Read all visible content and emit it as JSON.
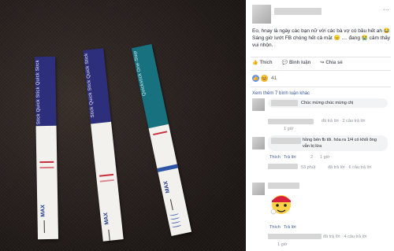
{
  "photo": {
    "strips": [
      {
        "handle_text": "Stick Quick Stick Quick Stick",
        "max_label": "MAX"
      },
      {
        "handle_text": "Stick Quick Stick Quick Stick",
        "max_label": "MAX"
      },
      {
        "handle_text": "Quickstick One-Step",
        "max_label": "MAX"
      }
    ]
  },
  "post": {
    "text": "Eo, hnay là ngày các bạn nữ vời các bà vợ có bầu hết ah 😂 Sáng giờ lướt FB chóng hết cả mặt 😑 .... đang 😭 cảm thấy vui nhộn.",
    "actions": {
      "like": "Thích",
      "comment": "Bình luận",
      "share": "Chia sẻ"
    },
    "reaction_count": "41",
    "colors": {
      "like": "#5890ff",
      "haha": "#f7b125",
      "link": "#385898"
    }
  },
  "comments_section": {
    "more_link": "Xem thêm 7 bình luận khác",
    "comments": [
      {
        "text": "Chúc mừng chúc mừng chị",
        "meta_left": "",
        "meta_right": "đã trả lời · 2 câu trả lời",
        "time": "1 giờ"
      },
      {
        "text": "hồng bén fb tôi. hóa ra 1/4 có khối ông vẫn bị lừa",
        "meta_like": "Thích",
        "meta_reply": "Trả lời",
        "like_count": "2",
        "time": "1 giờ",
        "meta_right": "đã trả lời · 6 câu trả lời",
        "extra": "53 phút"
      },
      {
        "text": "",
        "meta_like": "Thích",
        "meta_reply": "Trả lời",
        "time": "1 giờ",
        "meta_right": "đã trả lời · 4 câu trả lời"
      }
    ]
  }
}
